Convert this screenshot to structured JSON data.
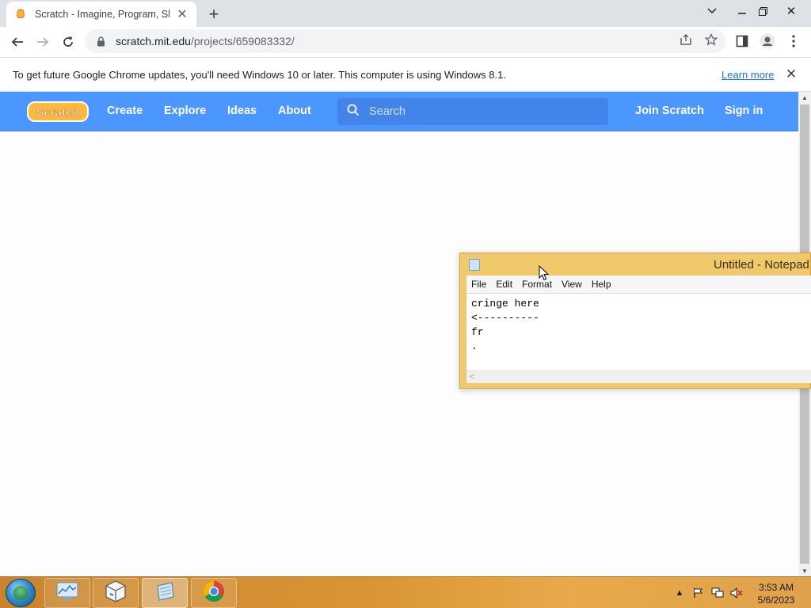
{
  "browser": {
    "tab": {
      "title": "Scratch - Imagine, Program, Share",
      "favicon": "scratch-cat-icon"
    },
    "window_controls": [
      "minimize",
      "restore",
      "close"
    ],
    "address": {
      "host": "scratch.mit.edu",
      "path": "/projects/659083332/"
    }
  },
  "infobar": {
    "message": "To get future Google Chrome updates, you'll need Windows 10 or later. This computer is using Windows 8.1.",
    "link": "Learn more"
  },
  "scratch_nav": {
    "logo": "Scratch",
    "links": [
      "Create",
      "Explore",
      "Ideas",
      "About"
    ],
    "search_placeholder": "Search",
    "join": "Join Scratch",
    "signin": "Sign in",
    "colors": {
      "nav_bg": "#4c97ff",
      "search_bg": "#4384ea"
    }
  },
  "notepad": {
    "title": "Untitled - Notepad",
    "menus": [
      "File",
      "Edit",
      "Format",
      "View",
      "Help"
    ],
    "content": "cringe here\n<----------\nfr\n."
  },
  "taskbar": {
    "apps": [
      "resource-monitor-icon",
      "virtualbox-icon",
      "notepad-icon",
      "chrome-icon"
    ],
    "time": "3:53 AM",
    "date": "5/6/2023"
  }
}
